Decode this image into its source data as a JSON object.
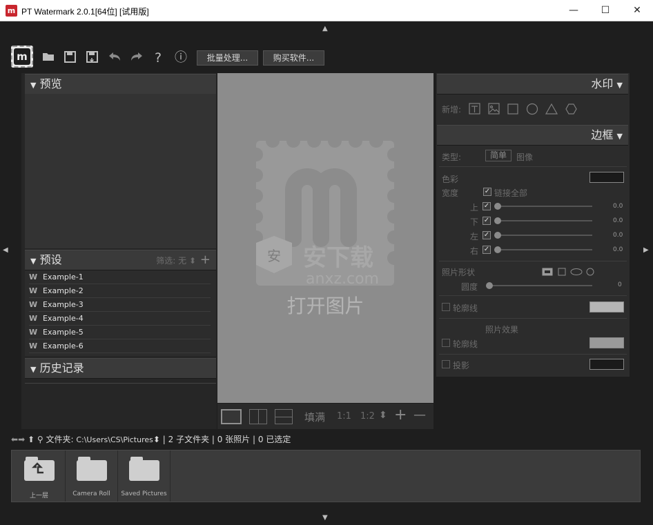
{
  "window": {
    "title": "PT Watermark 2.0.1[64位] [试用版]",
    "icon_glyph": "m",
    "minimize": "—",
    "maximize": "☐",
    "close": "✕"
  },
  "toolbar": {
    "logo_glyph": "m",
    "icons": [
      "folder-open-icon",
      "save-icon",
      "save-as-icon",
      "undo-icon",
      "redo-icon",
      "help-icon",
      "info-icon"
    ],
    "help_glyph": "?",
    "info_glyph": "ⓘ",
    "batch_label": "批量处理...",
    "buy_label": "购买软件..."
  },
  "left": {
    "preview_title": "预览",
    "presets_title": "预设",
    "filter_label": "筛选:",
    "filter_value": "无",
    "add_glyph": "+",
    "presets": [
      "Example-1",
      "Example-2",
      "Example-3",
      "Example-4",
      "Example-5",
      "Example-6"
    ],
    "history_title": "历史记录"
  },
  "center": {
    "open_image_label": "打开图片",
    "site_cn": "安下载",
    "site_domain": "anxz.com",
    "zoom_fill": "填满",
    "zoom_11": "1:1",
    "zoom_12": "1:2",
    "plus": "+",
    "minus": "—"
  },
  "right": {
    "watermark_title": "水印",
    "new_label": "新增:",
    "border_title": "边框",
    "type_label": "类型:",
    "type_simple": "简单",
    "type_image": "图像",
    "color_label": "色彩",
    "width_label": "宽度",
    "link_all": "链接全部",
    "sides": [
      {
        "label": "上",
        "value": "0.0"
      },
      {
        "label": "下",
        "value": "0.0"
      },
      {
        "label": "左",
        "value": "0.0"
      },
      {
        "label": "右",
        "value": "0.0"
      }
    ],
    "shape_label": "照片形状",
    "roundness_label": "圆度",
    "roundness_value": "0",
    "outline_label": "轮廓线",
    "photo_effect_label": "照片效果",
    "outline2_label": "轮廓线",
    "shadow_label": "投影",
    "colors": {
      "border_color": "#1a1a1a",
      "outline_color": "#b5b5b5",
      "outline2_color": "#9a9a9a",
      "shadow_color": "#1a1a1a"
    }
  },
  "pathbar": {
    "folder_label": "文件夹:",
    "path": "C:\\Users\\CS\\Pictures",
    "subfolders": "| 2 子文件夹",
    "photos": "| 0 张照片",
    "selected": "| 0 已选定"
  },
  "filmstrip": [
    {
      "label": "上一层",
      "icon": "folder-up-icon"
    },
    {
      "label": "Camera Roll",
      "icon": "folder-icon"
    },
    {
      "label": "Saved Pictures",
      "icon": "folder-icon"
    }
  ]
}
